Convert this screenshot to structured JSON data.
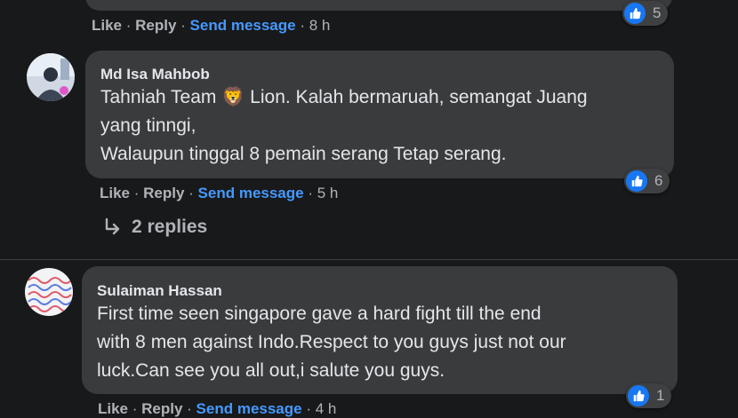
{
  "top": {
    "like_label": "Like",
    "reply_label": "Reply",
    "send_label": "Send message",
    "time": "8 h",
    "reaction_count": "5"
  },
  "comments": [
    {
      "author": "Md Isa Mahbob",
      "lines": [
        "Tahniah Team 🦁 Lion. Kalah bermaruah, semangat Juang",
        "yang tinngi,",
        "Walaupun tinggal 8 pemain serang Tetap serang."
      ],
      "like_label": "Like",
      "reply_label": "Reply",
      "send_label": "Send message",
      "time": "5 h",
      "reaction_count": "6",
      "replies_label": "2 replies"
    },
    {
      "author": "Sulaiman Hassan",
      "lines": [
        "First time seen singapore gave a hard fight till the end",
        "with 8 men against Indo.Respect to you guys just not our",
        "luck.Can see you all out,i salute you guys."
      ],
      "like_label": "Like",
      "reply_label": "Reply",
      "send_label": "Send message",
      "time": "4 h",
      "reaction_count": "1"
    }
  ],
  "colors": {
    "background": "#18191a",
    "bubble": "#3a3b3c",
    "link_blue": "#4599ff",
    "like_blue": "#1877f2"
  },
  "icons": [
    "like-icon",
    "reply-arrow-icon",
    "lion-emoji-icon"
  ]
}
